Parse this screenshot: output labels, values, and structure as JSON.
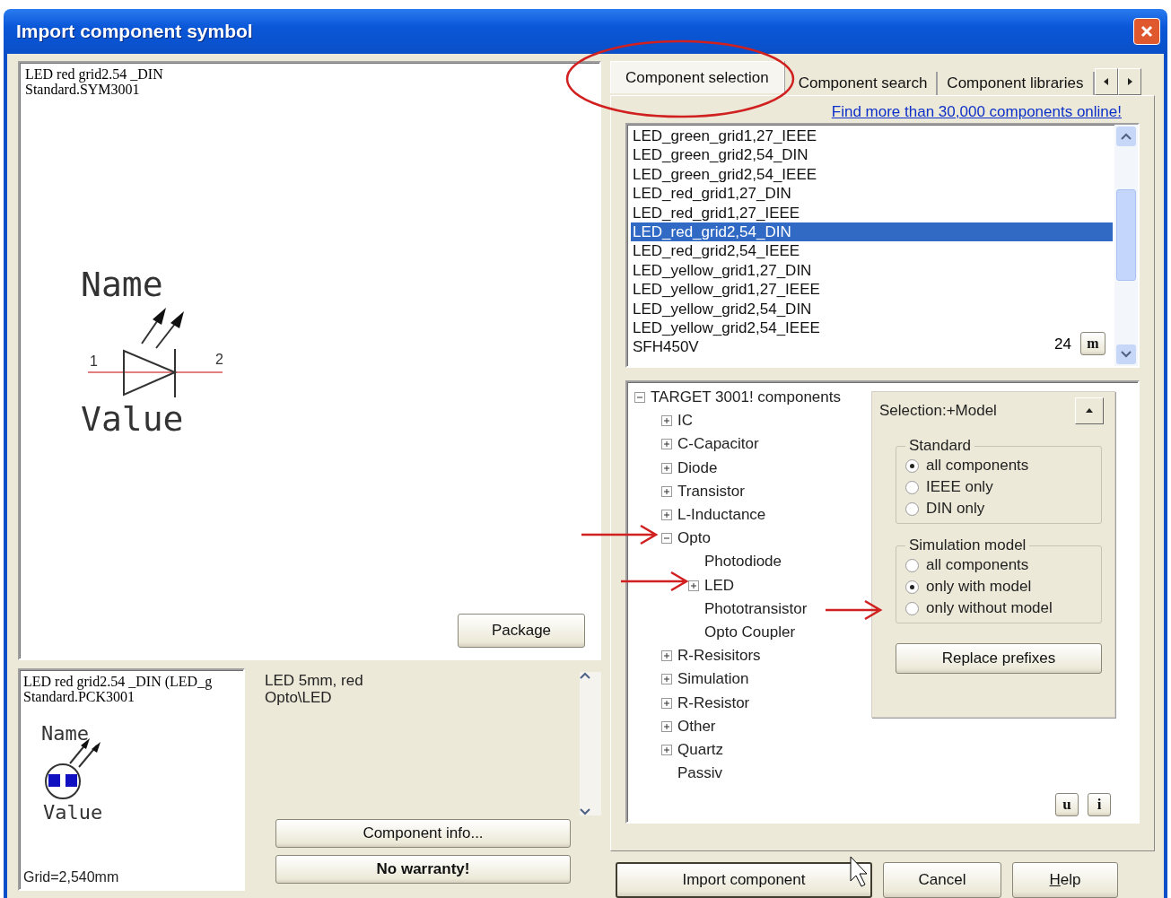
{
  "window": {
    "title": "Import component symbol"
  },
  "symbol_preview": {
    "lines": [
      "LED red grid2.54 _DIN",
      "Standard.SYM3001"
    ],
    "labels": {
      "name": "Name",
      "value": "Value",
      "pin_1": "1",
      "pin_2": "2"
    },
    "package_button": "Package"
  },
  "package_preview": {
    "lines": [
      "LED red grid2.54 _DIN (LED_g",
      "Standard.PCK3001"
    ],
    "labels": {
      "name": "Name",
      "value": "Value"
    },
    "grid": "Grid=2,540mm"
  },
  "info": {
    "lines": [
      "LED 5mm, red",
      "Opto\\LED"
    ],
    "buttons": [
      {
        "label": "Component info...",
        "bold": false
      },
      {
        "label": "No warranty!",
        "bold": true
      }
    ]
  },
  "tabs": [
    {
      "label": "Component selection",
      "selected": true
    },
    {
      "label": "Component search",
      "selected": false
    },
    {
      "label": "Component libraries",
      "selected": false
    }
  ],
  "link": "Find more than 30,000 components online!",
  "components": [
    {
      "label": "LED_green_grid1,27_IEEE",
      "selected": false
    },
    {
      "label": "LED_green_grid2,54_DIN",
      "selected": false
    },
    {
      "label": "LED_green_grid2,54_IEEE",
      "selected": false
    },
    {
      "label": "LED_red_grid1,27_DIN",
      "selected": false
    },
    {
      "label": "LED_red_grid1,27_IEEE",
      "selected": false
    },
    {
      "label": "LED_red_grid2,54_DIN",
      "selected": true
    },
    {
      "label": "LED_red_grid2,54_IEEE",
      "selected": false
    },
    {
      "label": "LED_yellow_grid1,27_DIN",
      "selected": false
    },
    {
      "label": "LED_yellow_grid1,27_IEEE",
      "selected": false
    },
    {
      "label": "LED_yellow_grid2,54_DIN",
      "selected": false
    },
    {
      "label": "LED_yellow_grid2,54_IEEE",
      "selected": false
    },
    {
      "label": "SFH450V",
      "selected": false
    }
  ],
  "count": "24",
  "m_button": "m",
  "tree": {
    "label": "TARGET 3001! components",
    "expanded": true,
    "children": [
      {
        "label": "IC",
        "expanded": false
      },
      {
        "label": "C-Capacitor",
        "expanded": false
      },
      {
        "label": "Diode",
        "expanded": false
      },
      {
        "label": "Transistor",
        "expanded": false
      },
      {
        "label": "L-Inductance",
        "expanded": false
      },
      {
        "label": "Opto",
        "expanded": true,
        "children": [
          {
            "label": "Photodiode"
          },
          {
            "label": "LED",
            "expanded": false
          },
          {
            "label": "Phototransistor"
          },
          {
            "label": "Opto Coupler"
          }
        ]
      },
      {
        "label": "R-Resisitors",
        "expanded": false
      },
      {
        "label": "Simulation",
        "expanded": false
      },
      {
        "label": "R-Resistor",
        "expanded": false
      },
      {
        "label": "Other",
        "expanded": false
      },
      {
        "label": "Quartz",
        "expanded": false
      },
      {
        "label": "Passiv"
      }
    ]
  },
  "selection_panel": {
    "title": "Selection:+Model",
    "groups": [
      {
        "title": "Standard",
        "options": [
          {
            "label": "all components",
            "selected": true
          },
          {
            "label": "IEEE only",
            "selected": false
          },
          {
            "label": "DIN only",
            "selected": false
          }
        ]
      },
      {
        "title": "Simulation model",
        "options": [
          {
            "label": "all components",
            "selected": false
          },
          {
            "label": "only with model",
            "selected": true
          },
          {
            "label": "only without model",
            "selected": false
          }
        ]
      }
    ],
    "button": "Replace prefixes"
  },
  "small_buttons": [
    "u",
    "i"
  ],
  "buttons": [
    {
      "label": "Import component",
      "default": true
    },
    {
      "label": "Cancel",
      "default": false
    },
    {
      "label": "Help",
      "default": false
    }
  ]
}
